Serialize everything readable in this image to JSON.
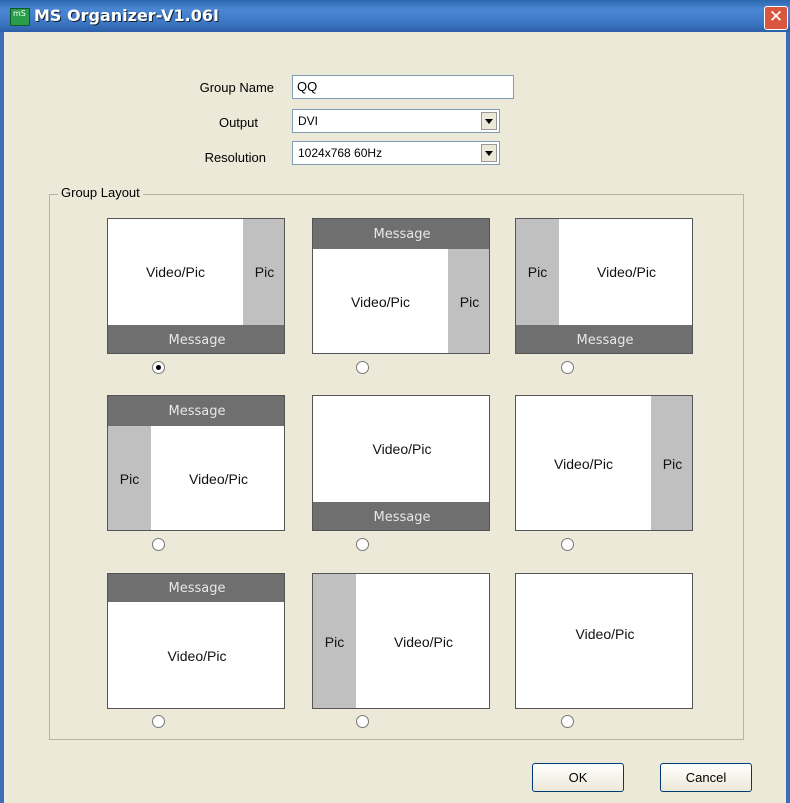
{
  "window": {
    "title": "MS Organizer-V1.06I",
    "icon_text": "mS"
  },
  "form": {
    "group_name_label": "Group Name",
    "group_name_value": "QQ",
    "output_label": "Output",
    "output_value": "DVI",
    "resolution_label": "Resolution",
    "resolution_value": "1024x768 60Hz"
  },
  "group_layout": {
    "title": "Group Layout",
    "selected_index": 0,
    "layouts": [
      {
        "video": "Video/Pic",
        "pic": "Pic",
        "message": "Message"
      },
      {
        "message": "Message",
        "video": "Video/Pic",
        "pic": "Pic"
      },
      {
        "pic": "Pic",
        "video": "Video/Pic",
        "message": "Message"
      },
      {
        "message": "Message",
        "pic": "Pic",
        "video": "Video/Pic"
      },
      {
        "video": "Video/Pic",
        "message": "Message"
      },
      {
        "video": "Video/Pic",
        "pic": "Pic"
      },
      {
        "message": "Message",
        "video": "Video/Pic"
      },
      {
        "pic": "Pic",
        "video": "Video/Pic"
      },
      {
        "video": "Video/Pic"
      }
    ]
  },
  "buttons": {
    "ok": "OK",
    "cancel": "Cancel"
  }
}
